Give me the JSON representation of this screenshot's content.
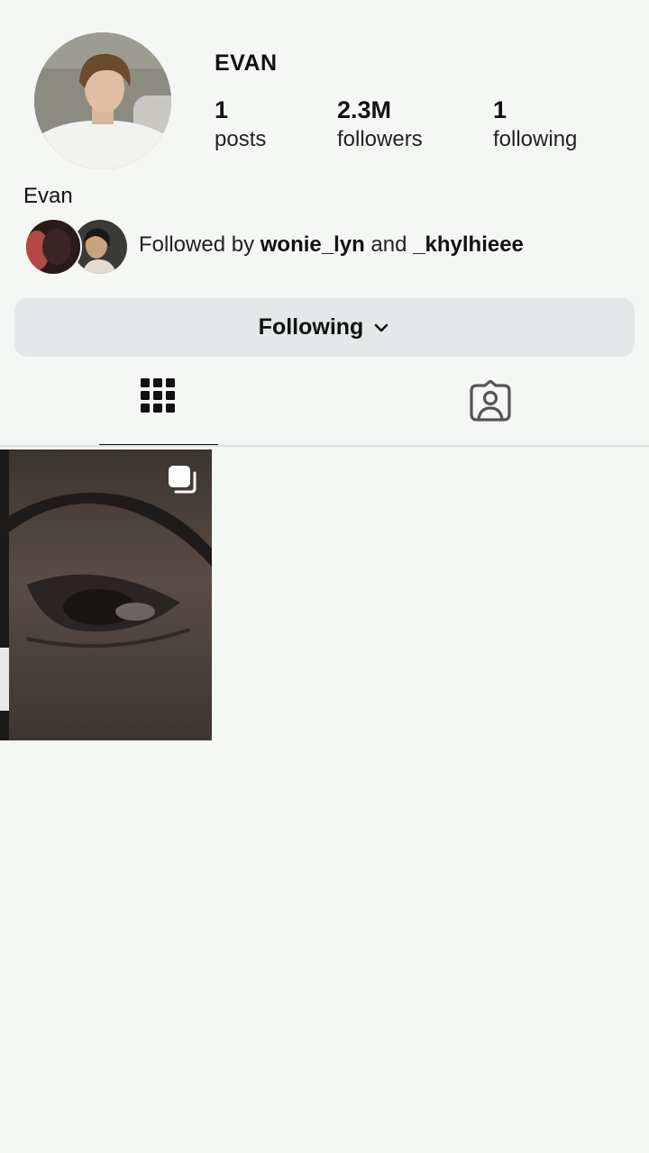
{
  "profile": {
    "username": "EVAN",
    "display_name": "Evan",
    "avatar_icon": "profile-photo"
  },
  "stats": {
    "posts": {
      "value": "1",
      "label": "posts"
    },
    "followers": {
      "value": "2.3M",
      "label": "followers"
    },
    "following": {
      "value": "1",
      "label": "following"
    }
  },
  "mutuals": {
    "prefix": "Followed by ",
    "user1": "wonie_lyn",
    "joiner": " and ",
    "user2": "_khylhieee"
  },
  "actions": {
    "following_label": "Following",
    "following_icon": "chevron-down-icon"
  },
  "tabs": [
    {
      "name": "grid",
      "icon": "grid-icon",
      "active": true
    },
    {
      "name": "tagged",
      "icon": "tagged-person-icon",
      "active": false
    }
  ],
  "posts": [
    {
      "type": "carousel",
      "icon": "multiple-photos-icon"
    }
  ],
  "colors": {
    "background": "#f5f7f5",
    "button_bg": "#e5e8e8",
    "text": "#111111"
  }
}
